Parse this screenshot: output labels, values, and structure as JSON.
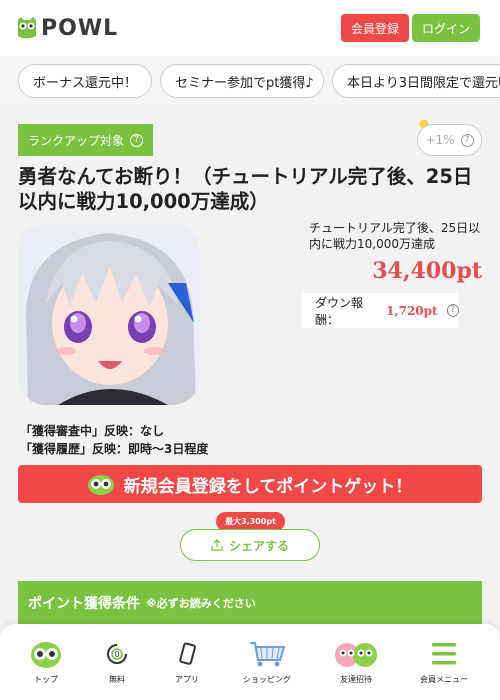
{
  "header": {
    "logo_text": "POWL",
    "register_label": "会員登録",
    "login_label": "ログイン"
  },
  "chips": [
    "ボーナス還元中！",
    "セミナー参加でpt獲得♪",
    "本日より3日間限定で還元U"
  ],
  "offer": {
    "rank_badge": "ランクアップ対象",
    "rate": "+1%",
    "title": "勇者なんてお断り！（チュートリアル完了後、25日以内に戦力10,000万達成）",
    "description": "チュートリアル完了後、25日以内に戦力10,000万達成",
    "points": "34,400pt",
    "down_label": "ダウン報酬：",
    "down_value": "1,720pt",
    "note_pending": "「獲得審査中」反映：なし",
    "note_history": "「獲得履歴」反映：即時～3日程度",
    "cta_label": "新規会員登録をしてポイントゲット！",
    "share_max": "最大3,300pt",
    "share_label": "シェアする",
    "conditions_title": "ポイント獲得条件",
    "conditions_sub": "※必ずお読みください"
  },
  "bottom_nav": [
    {
      "label": "トップ",
      "icon": "owl-icon"
    },
    {
      "label": "無料",
      "icon": "zero-yen-icon"
    },
    {
      "label": "アプリ",
      "icon": "smartphone-icon"
    },
    {
      "label": "ショッピング",
      "icon": "cart-icon"
    },
    {
      "label": "友達招待",
      "icon": "friends-icon"
    },
    {
      "label": "会員メニュー",
      "icon": "menu-icon"
    }
  ],
  "colors": {
    "brand_green": "#7cc241",
    "accent_red": "#f04747"
  }
}
